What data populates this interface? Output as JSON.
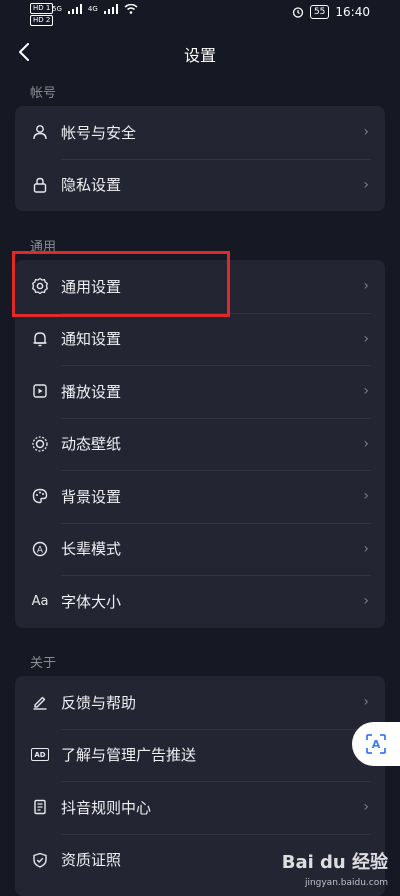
{
  "status_bar": {
    "hd1": "HD 1",
    "hd2": "HD 2",
    "net1": "5G",
    "net2": "4G",
    "battery": "55",
    "time": "16:40"
  },
  "header": {
    "title": "设置"
  },
  "sections": [
    {
      "label": "帐号",
      "items": [
        {
          "label": "帐号与安全",
          "icon": "person-icon"
        },
        {
          "label": "隐私设置",
          "icon": "lock-icon"
        }
      ]
    },
    {
      "label": "通用",
      "items": [
        {
          "label": "通用设置",
          "icon": "gear-icon"
        },
        {
          "label": "通知设置",
          "icon": "bell-icon"
        },
        {
          "label": "播放设置",
          "icon": "play-settings-icon"
        },
        {
          "label": "动态壁纸",
          "icon": "wallpaper-icon"
        },
        {
          "label": "背景设置",
          "icon": "palette-icon"
        },
        {
          "label": "长辈模式",
          "icon": "elder-mode-icon"
        },
        {
          "label": "字体大小",
          "icon": "font-size-icon",
          "icon_text": "Aa"
        }
      ]
    },
    {
      "label": "关于",
      "items": [
        {
          "label": "反馈与帮助",
          "icon": "pencil-icon"
        },
        {
          "label": "了解与管理广告推送",
          "icon": "ad-icon",
          "icon_text": "AD"
        },
        {
          "label": "抖音规则中心",
          "icon": "document-icon"
        },
        {
          "label": "资质证照",
          "icon": "shield-check-icon"
        }
      ]
    }
  ],
  "float_button": {
    "icon": "scan-text-icon",
    "text": "A"
  },
  "watermark": {
    "text": "Bai du 经验",
    "sub": "jingyan.baidu.com"
  },
  "colors": {
    "background": "#161823",
    "card": "#232532",
    "highlight": "#e02a2a"
  }
}
